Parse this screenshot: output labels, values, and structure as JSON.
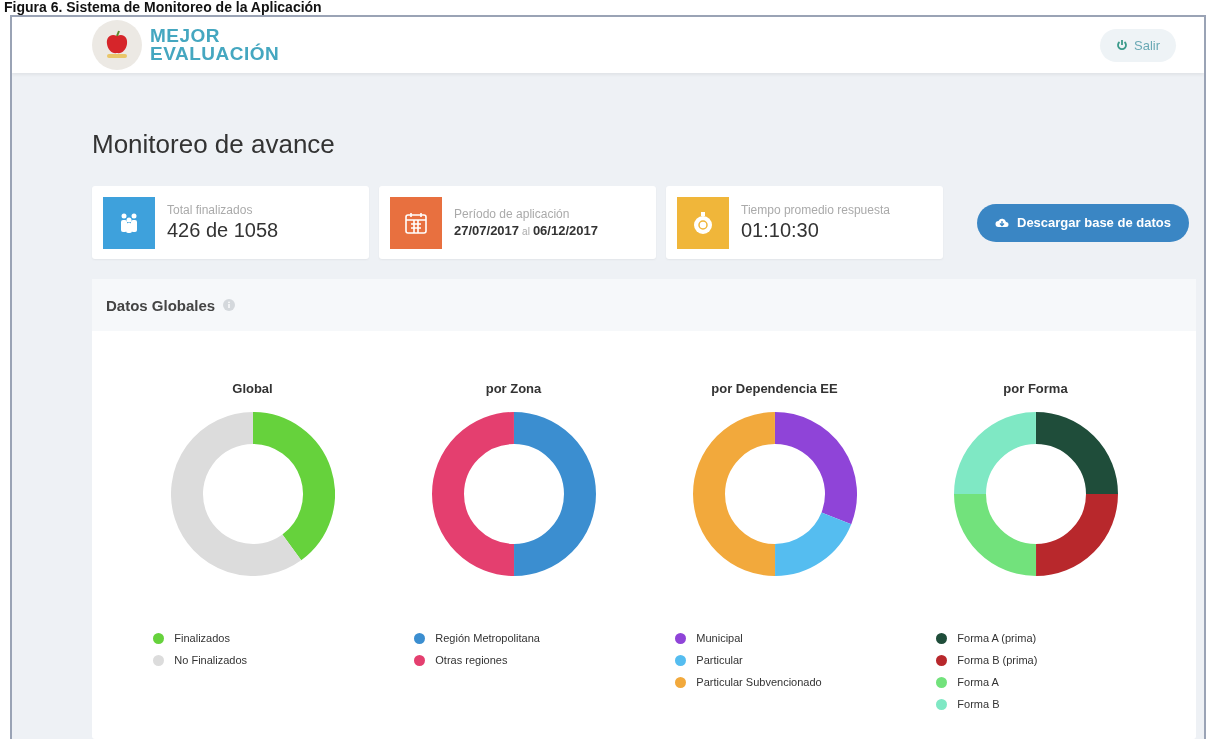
{
  "caption": "Figura 6. Sistema de Monitoreo de la Aplicación",
  "header": {
    "brand_line_1": "MEJOR",
    "brand_line_2": "EVALUACIÓN",
    "logout": "Salir"
  },
  "title": "Monitoreo de avance",
  "stats": [
    {
      "kind": "people",
      "color": "#3ea1dc",
      "label": "Total finalizados",
      "value": "426 de 1058"
    },
    {
      "kind": "calendar",
      "color": "#e8703f",
      "label": "Período de aplicación",
      "value": "27/07/2017",
      "connector": "al",
      "value_2": "06/12/2017"
    },
    {
      "kind": "timer",
      "color": "#f0b63a",
      "label": "Tiempo promedio respuesta",
      "value": "01:10:30"
    }
  ],
  "download_button": "Descargar base de datos",
  "panel": {
    "title": "Datos Globales",
    "charts": [
      {
        "title": "Global",
        "legend": [
          {
            "label": "Finalizados",
            "color": "#66d23c"
          },
          {
            "label": "No Finalizados",
            "color": "#dcdcdc"
          }
        ]
      },
      {
        "title": "por Zona",
        "legend": [
          {
            "label": "Región Metropolitana",
            "color": "#3b8ed0"
          },
          {
            "label": "Otras regiones",
            "color": "#e43f6f"
          }
        ]
      },
      {
        "title": "por Dependencia EE",
        "legend": [
          {
            "label": "Municipal",
            "color": "#8f44d8"
          },
          {
            "label": "Particular",
            "color": "#55bdf0"
          },
          {
            "label": "Particular Subvencionado",
            "color": "#f2a93c"
          }
        ]
      },
      {
        "title": "por Forma",
        "legend": [
          {
            "label": "Forma A (prima)",
            "color": "#1f4d3a"
          },
          {
            "label": "Forma B (prima)",
            "color": "#b8282c"
          },
          {
            "label": "Forma A",
            "color": "#72e27c"
          },
          {
            "label": "Forma B",
            "color": "#7fe8c4"
          }
        ]
      }
    ]
  }
}
